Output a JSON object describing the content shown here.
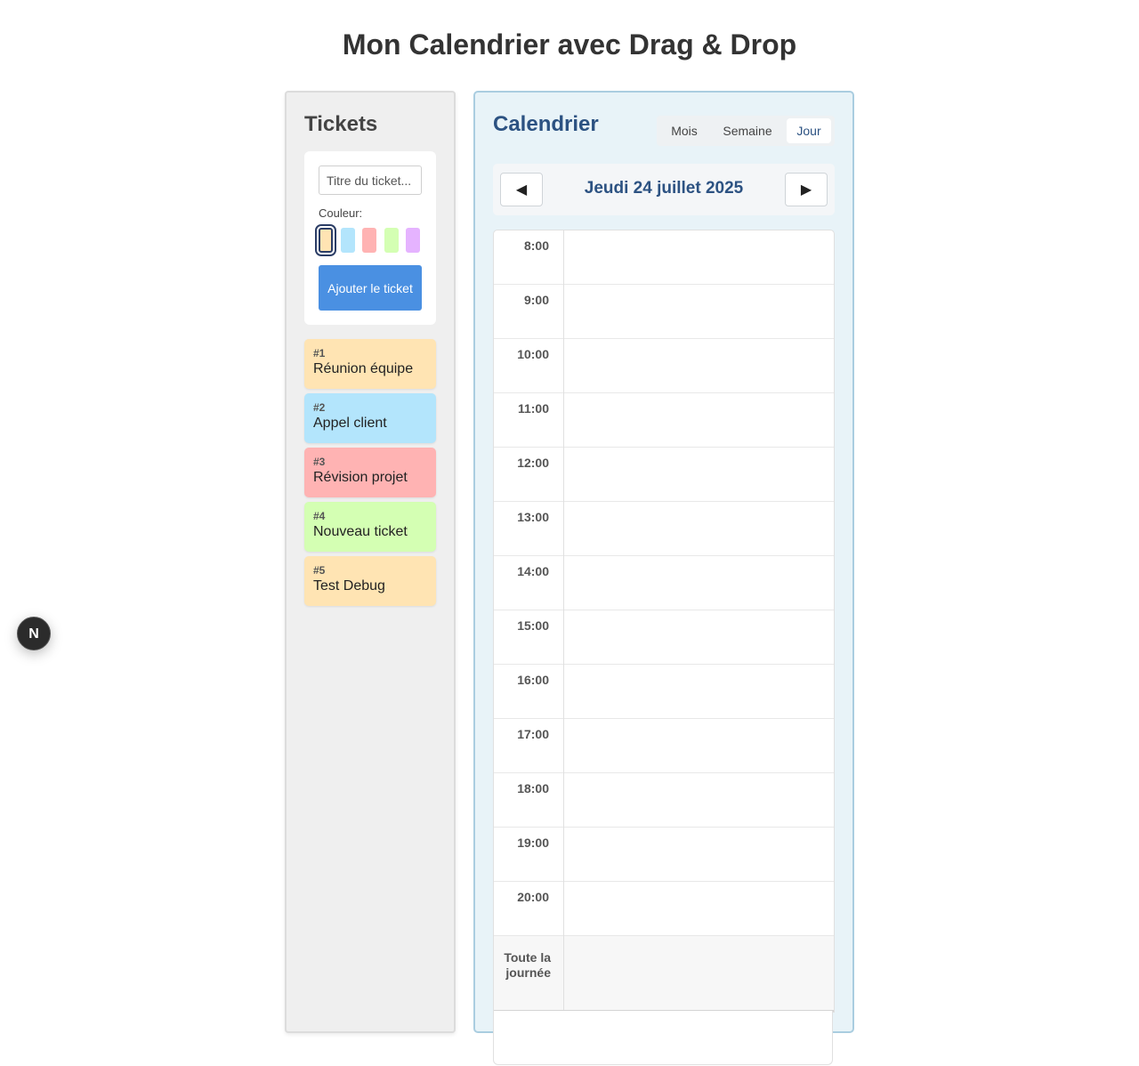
{
  "page": {
    "title": "Mon Calendrier avec Drag & Drop"
  },
  "tickets_panel": {
    "heading": "Tickets",
    "form": {
      "title_placeholder": "Titre du ticket...",
      "color_label": "Couleur:",
      "colors": [
        "#ffe4b3",
        "#b3e5fc",
        "#ffb3b3",
        "#d4ffb3",
        "#e5b3ff"
      ],
      "selected_color_index": 0,
      "add_button": "Ajouter le ticket"
    },
    "tickets": [
      {
        "num": "#1",
        "title": "Réunion équipe",
        "color": "#ffe4b3"
      },
      {
        "num": "#2",
        "title": "Appel client",
        "color": "#b3e5fc"
      },
      {
        "num": "#3",
        "title": "Révision projet",
        "color": "#ffb3b3"
      },
      {
        "num": "#4",
        "title": "Nouveau ticket",
        "color": "#d4ffb3"
      },
      {
        "num": "#5",
        "title": "Test Debug",
        "color": "#ffe4b3"
      }
    ]
  },
  "calendar": {
    "heading": "Calendrier",
    "views": [
      "Mois",
      "Semaine",
      "Jour"
    ],
    "active_view": "Jour",
    "prev_icon": "◀",
    "next_icon": "▶",
    "date_label": "Jeudi 24 juillet 2025",
    "hours": [
      "8:00",
      "9:00",
      "10:00",
      "11:00",
      "12:00",
      "13:00",
      "14:00",
      "15:00",
      "16:00",
      "17:00",
      "18:00",
      "19:00",
      "20:00"
    ],
    "all_day_label": "Toute la journée"
  },
  "dev_badge": {
    "label": "N"
  }
}
